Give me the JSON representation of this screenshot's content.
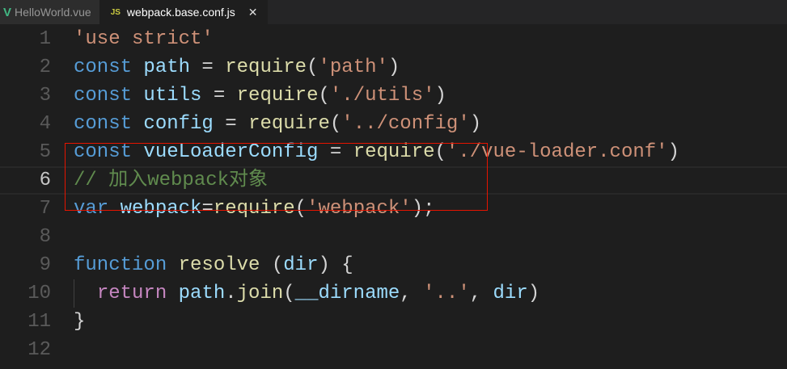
{
  "tabs": [
    {
      "label": "HelloWorld.vue",
      "icon": "vue-icon",
      "icon_text": "V"
    },
    {
      "label": "webpack.base.conf.js",
      "icon": "js-icon",
      "icon_text": "JS",
      "close": "✕"
    }
  ],
  "colors": {
    "keyword": "#569cd6",
    "string": "#ce9178",
    "variable": "#9cdcfe",
    "function": "#dcdcaa",
    "comment": "#608b4e",
    "control": "#c586c0",
    "plain": "#d4d4d4"
  },
  "lines": [
    {
      "n": "1",
      "tokens": [
        [
          "'use strict'",
          "string"
        ]
      ]
    },
    {
      "n": "2",
      "tokens": [
        [
          "const ",
          "keyword"
        ],
        [
          "path",
          "variable"
        ],
        [
          " = ",
          "plain"
        ],
        [
          "require",
          "function"
        ],
        [
          "(",
          "plain"
        ],
        [
          "'path'",
          "string"
        ],
        [
          ")",
          "plain"
        ]
      ]
    },
    {
      "n": "3",
      "tokens": [
        [
          "const ",
          "keyword"
        ],
        [
          "utils",
          "variable"
        ],
        [
          " = ",
          "plain"
        ],
        [
          "require",
          "function"
        ],
        [
          "(",
          "plain"
        ],
        [
          "'./utils'",
          "string"
        ],
        [
          ")",
          "plain"
        ]
      ]
    },
    {
      "n": "4",
      "tokens": [
        [
          "const ",
          "keyword"
        ],
        [
          "config",
          "variable"
        ],
        [
          " = ",
          "plain"
        ],
        [
          "require",
          "function"
        ],
        [
          "(",
          "plain"
        ],
        [
          "'../config'",
          "string"
        ],
        [
          ")",
          "plain"
        ]
      ]
    },
    {
      "n": "5",
      "tokens": [
        [
          "const ",
          "keyword"
        ],
        [
          "vueLoaderConfig",
          "variable"
        ],
        [
          " = ",
          "plain"
        ],
        [
          "require",
          "function"
        ],
        [
          "(",
          "plain"
        ],
        [
          "'./vue-loader.conf'",
          "string"
        ],
        [
          ")",
          "plain"
        ]
      ]
    },
    {
      "n": "6",
      "tokens": [
        [
          "// 加入webpack对象",
          "comment"
        ]
      ],
      "current": true
    },
    {
      "n": "7",
      "tokens": [
        [
          "var ",
          "keyword"
        ],
        [
          "webpack",
          "variable"
        ],
        [
          "=",
          "plain"
        ],
        [
          "require",
          "function"
        ],
        [
          "(",
          "plain"
        ],
        [
          "'webpack'",
          "string"
        ],
        [
          ");",
          "plain"
        ]
      ]
    },
    {
      "n": "8",
      "tokens": []
    },
    {
      "n": "9",
      "tokens": [
        [
          "function ",
          "keyword"
        ],
        [
          "resolve",
          "function"
        ],
        [
          " (",
          "plain"
        ],
        [
          "dir",
          "variable"
        ],
        [
          ") {",
          "plain"
        ]
      ]
    },
    {
      "n": "10",
      "tokens": [
        [
          "  ",
          "plain"
        ],
        [
          "return ",
          "control"
        ],
        [
          "path",
          "variable"
        ],
        [
          ".",
          "plain"
        ],
        [
          "join",
          "function"
        ],
        [
          "(",
          "plain"
        ],
        [
          "__dirname",
          "variable"
        ],
        [
          ", ",
          "plain"
        ],
        [
          "'..'",
          "string"
        ],
        [
          ", ",
          "plain"
        ],
        [
          "dir",
          "variable"
        ],
        [
          ")",
          "plain"
        ]
      ],
      "guide": true
    },
    {
      "n": "11",
      "tokens": [
        [
          "}",
          "plain"
        ]
      ]
    },
    {
      "n": "12",
      "tokens": []
    }
  ]
}
